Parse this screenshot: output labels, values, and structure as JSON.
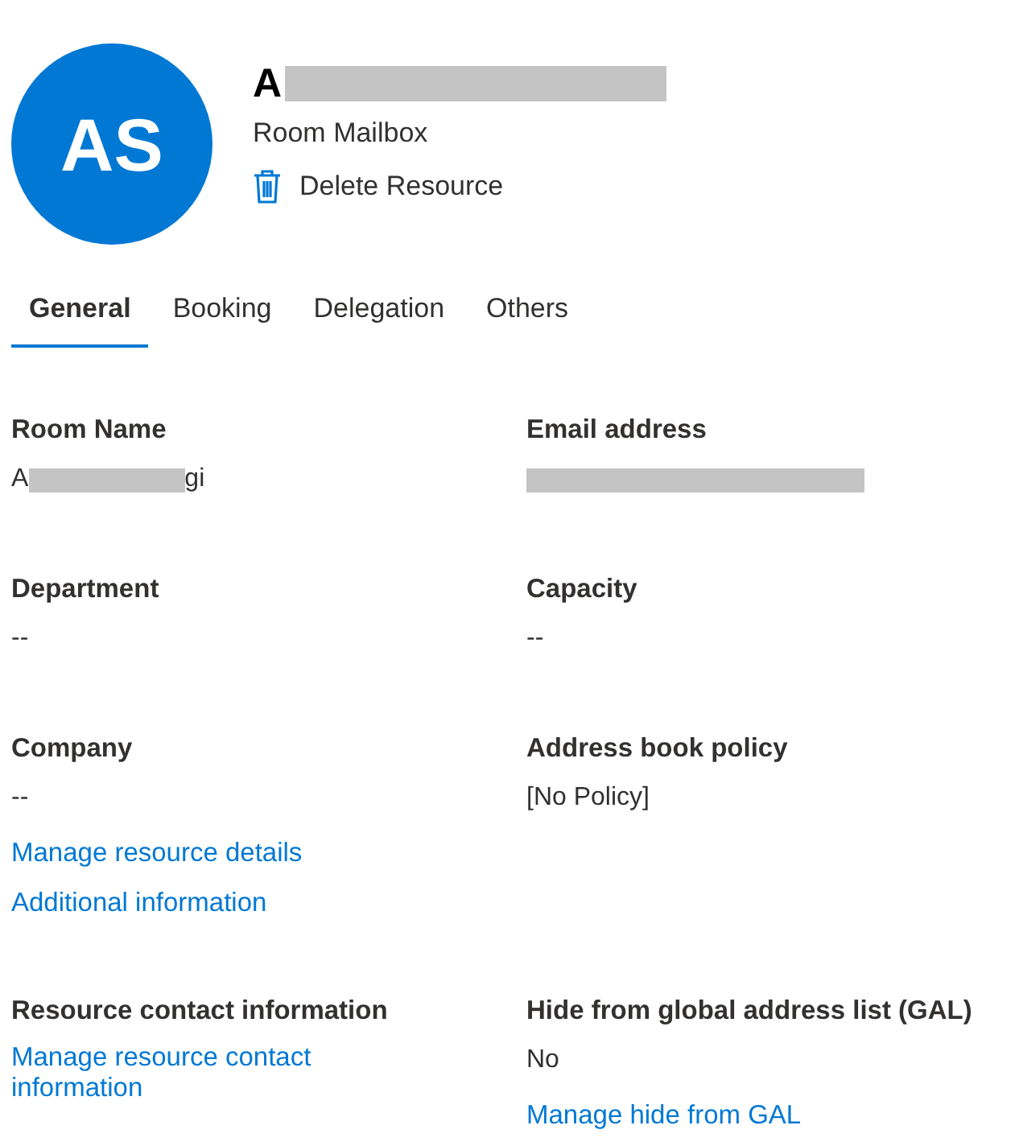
{
  "header": {
    "initials": "AS",
    "name": {
      "start": "A",
      "redacted": true
    },
    "subtitle": "Room Mailbox",
    "action": "Delete Resource"
  },
  "tabs": [
    {
      "label": "General",
      "selected": true
    },
    {
      "label": "Booking",
      "selected": false
    },
    {
      "label": "Delegation",
      "selected": false
    },
    {
      "label": "Others",
      "selected": false
    }
  ],
  "fields": [
    {
      "label": "Room Name",
      "value": {
        "start": "A",
        "redacted": true,
        "end": "gi"
      }
    },
    {
      "label": "Email address",
      "value": {
        "redacted": true
      }
    },
    {
      "label": "Department",
      "value": {
        "start": "--"
      }
    },
    {
      "label": "Capacity",
      "value": {
        "start": "--"
      }
    },
    {
      "label": "Company",
      "value": {
        "start": "--"
      },
      "links": [
        "Manage resource details",
        "Additional information"
      ]
    },
    {
      "label": "Address book policy",
      "value": {
        "start": "[No Policy]"
      }
    },
    {
      "label": "Resource contact information",
      "links": [
        "Manage resource contact information"
      ]
    },
    {
      "label": "Hide from global address list (GAL)",
      "value": {
        "start": "No"
      },
      "links": [
        "Manage hide from GAL"
      ]
    }
  ]
}
